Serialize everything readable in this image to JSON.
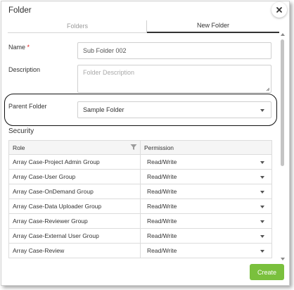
{
  "dialog": {
    "title": "Folder",
    "close_icon": "close-icon"
  },
  "tabs": [
    {
      "label": "Folders",
      "active": false
    },
    {
      "label": "New Folder",
      "active": true
    }
  ],
  "form": {
    "name_label": "Name",
    "required_mark": "*",
    "name_value": "Sub Folder 002",
    "description_label": "Description",
    "description_placeholder": "Folder Description",
    "parent_label": "Parent Folder",
    "parent_value": "Sample Folder"
  },
  "security": {
    "title": "Security",
    "columns": {
      "role": "Role",
      "permission": "Permission"
    },
    "rows": [
      {
        "role": "Array Case-Project Admin Group",
        "permission": "Read/Write"
      },
      {
        "role": "Array Case-User Group",
        "permission": "Read/Write"
      },
      {
        "role": "Array Case-OnDemand Group",
        "permission": "Read/Write"
      },
      {
        "role": "Array Case-Data Uploader Group",
        "permission": "Read/Write"
      },
      {
        "role": "Array Case-Reviewer Group",
        "permission": "Read/Write"
      },
      {
        "role": "Array Case-External User Group",
        "permission": "Read/Write"
      },
      {
        "role": "Array Case-Review",
        "permission": "Read/Write"
      }
    ]
  },
  "actions": {
    "create_label": "Create"
  },
  "colors": {
    "accent_green": "#7ac03d",
    "required_red": "#e02020"
  }
}
